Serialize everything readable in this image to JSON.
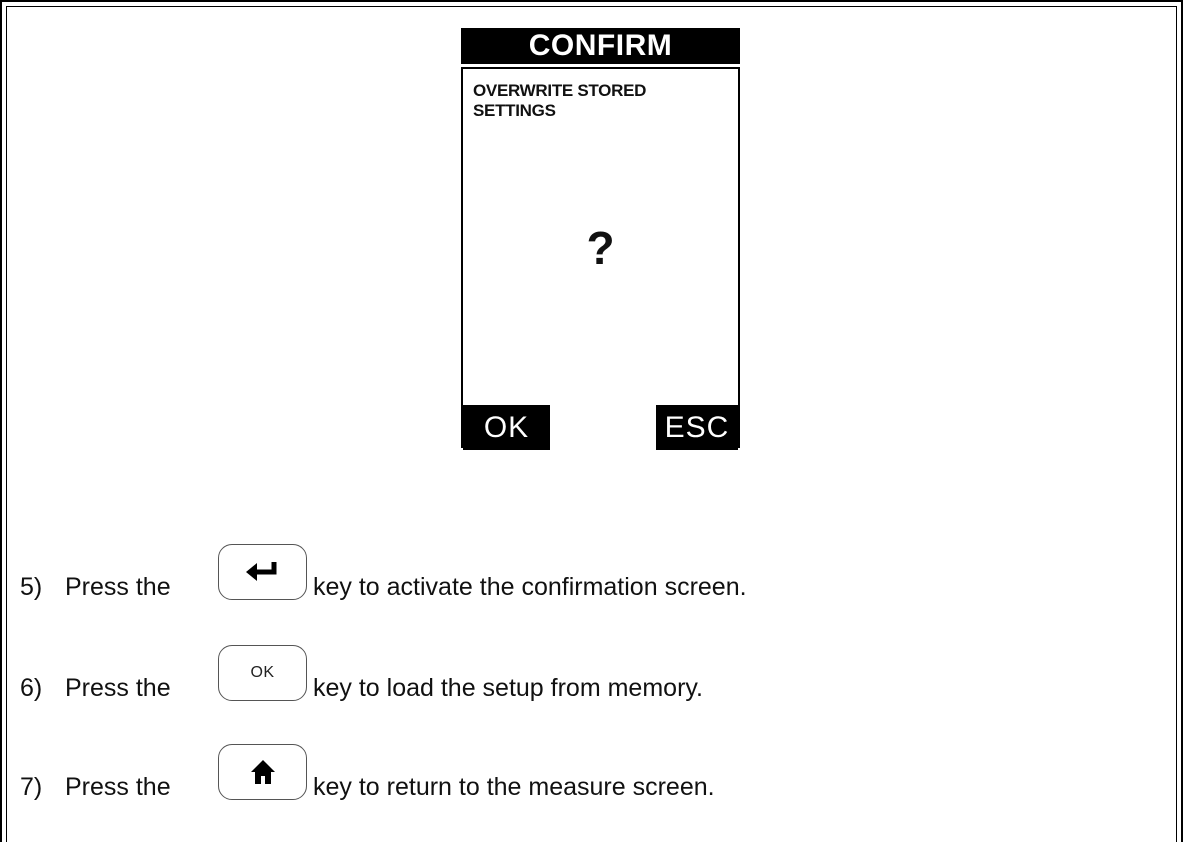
{
  "device_screen": {
    "title": "CONFIRM",
    "message": "OVERWRITE STORED SETTINGS",
    "question": "?",
    "softkey_left": "OK",
    "softkey_right": "ESC"
  },
  "steps": [
    {
      "number": "5)",
      "prefix": "Press the",
      "key_icon": "enter-icon",
      "suffix": "key to activate the confirmation screen."
    },
    {
      "number": "6)",
      "prefix": "Press the",
      "key_label": "OK",
      "suffix": "key to load the setup from memory."
    },
    {
      "number": "7)",
      "prefix": "Press the",
      "key_icon": "home-icon",
      "suffix": "key to return to the measure screen."
    }
  ]
}
